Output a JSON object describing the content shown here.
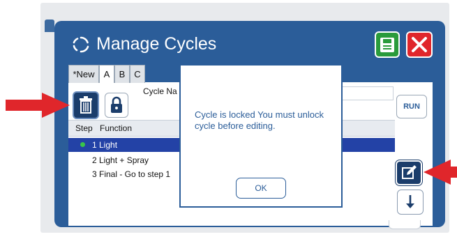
{
  "window": {
    "title": "Manage Cycles"
  },
  "tabs": [
    {
      "label": "*New"
    },
    {
      "label": "A"
    },
    {
      "label": "B"
    },
    {
      "label": "C"
    }
  ],
  "toolbar": {
    "cycle_name_label": "Cycle Na",
    "run_label": "RUN"
  },
  "table": {
    "columns": [
      "Step",
      "Function"
    ],
    "rows": [
      {
        "text": "1 Light",
        "selected": true
      },
      {
        "text": "2 Light + Spray",
        "selected": false
      },
      {
        "text": "3 Final - Go to step 1",
        "selected": false
      }
    ]
  },
  "dialog": {
    "message": "Cycle is locked  You must unlock cycle before editing.",
    "ok_label": "OK"
  },
  "icons": [
    "refresh-icon",
    "save-icon",
    "close-icon",
    "trash-icon",
    "lock-icon",
    "edit-icon",
    "arrow-down-icon"
  ],
  "colors": {
    "panel": "#2b5d99",
    "save": "#2a9b3b",
    "close": "#e0262b",
    "selected_row": "#2342a6",
    "callout_arrow": "#e0262b"
  }
}
